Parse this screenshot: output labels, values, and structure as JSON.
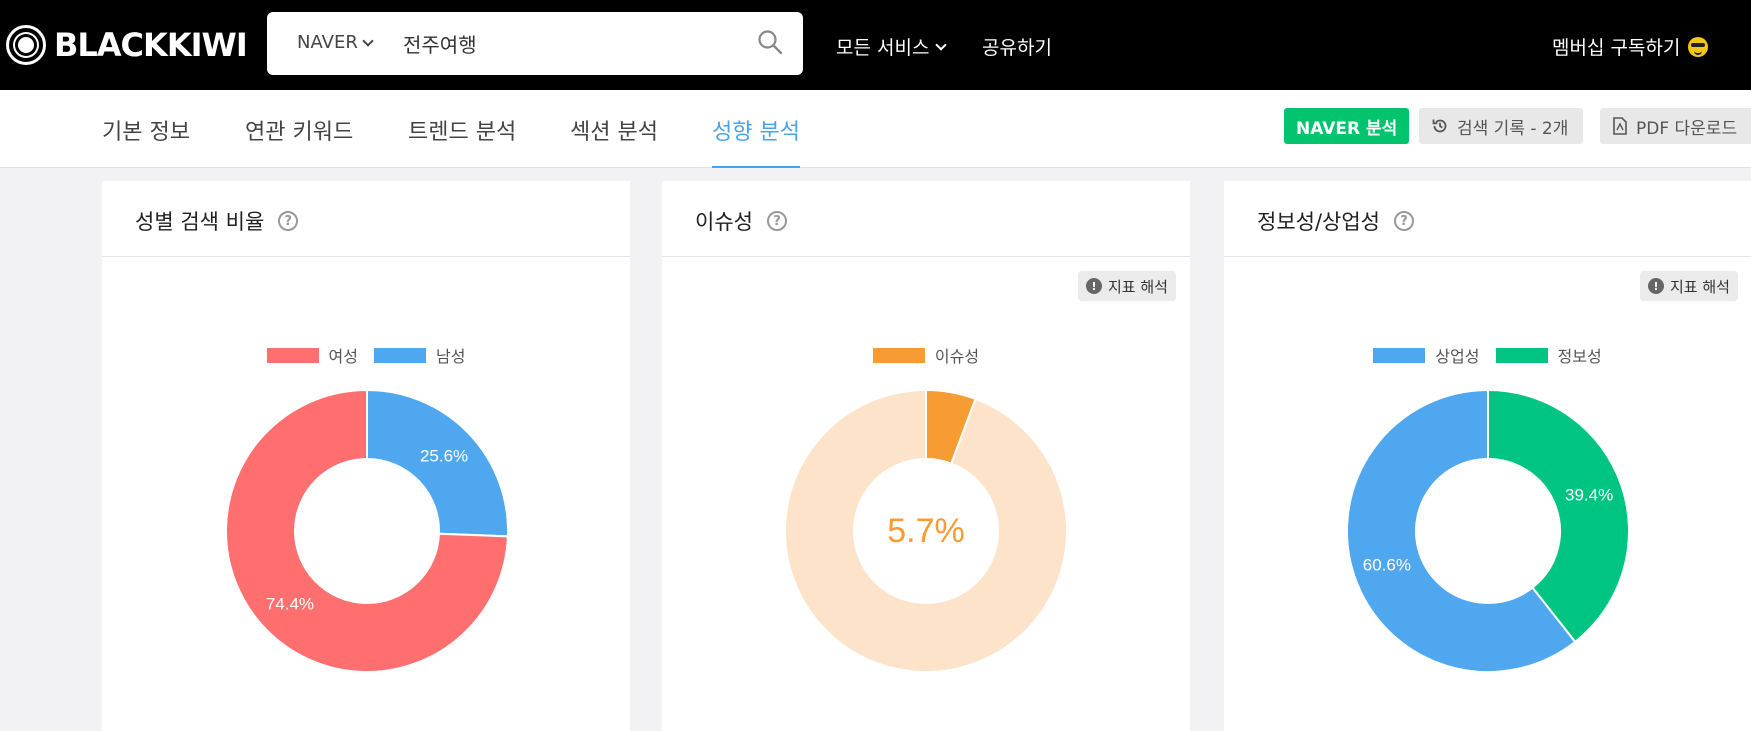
{
  "brand": {
    "name": "BLACKKIWI"
  },
  "search": {
    "engine": "NAVER",
    "query": "전주여행"
  },
  "top_nav": {
    "services": "모든 서비스",
    "share": "공유하기",
    "membership": "멤버십 구독하기"
  },
  "tabs": [
    "기본 정보",
    "연관 키워드",
    "트렌드 분석",
    "섹션 분석",
    "성향 분석"
  ],
  "active_tab": "성향 분석",
  "actions": {
    "naver_analysis": "NAVER 분석",
    "history": "검색 기록 - 2개",
    "pdf": "PDF 다운로드"
  },
  "help_symbol": "?",
  "interp_label": "지표 해석",
  "colors": {
    "female": "#ff6f6f",
    "male": "#4fa7f0",
    "issue": "#f79b33",
    "issue_bg": "#fde3c9",
    "commercial": "#4fa7f0",
    "informational": "#00c482",
    "active_tab": "#4aa3e8",
    "naver_green": "#03c46e"
  },
  "chart_data": [
    {
      "type": "pie",
      "title": "성별 검색 비율",
      "series": [
        {
          "name": "여성",
          "value": 74.4,
          "label": "74.4%"
        },
        {
          "name": "남성",
          "value": 25.6,
          "label": "25.6%"
        }
      ]
    },
    {
      "type": "pie",
      "title": "이슈성",
      "series": [
        {
          "name": "이슈성",
          "value": 5.7
        }
      ],
      "center_label": "5.7%"
    },
    {
      "type": "pie",
      "title": "정보성/상업성",
      "series": [
        {
          "name": "상업성",
          "value": 60.6,
          "label": "60.6%"
        },
        {
          "name": "정보성",
          "value": 39.4,
          "label": "39.4%"
        }
      ]
    }
  ]
}
